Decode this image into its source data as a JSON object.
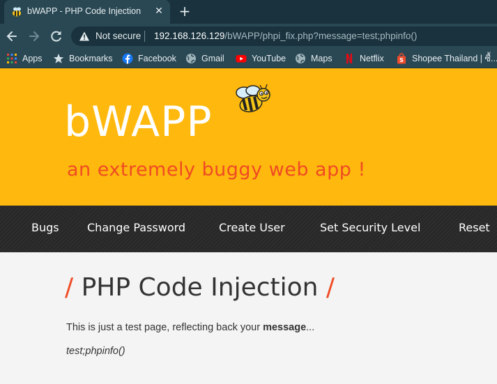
{
  "browser": {
    "tab_title": "bWAPP - PHP Code Injection",
    "close_glyph": "✕",
    "new_tab_glyph": "+",
    "security_label": "Not secure",
    "url_host": "192.168.126.129",
    "url_path": "/bWAPP/phpi_fix.php?message=test;phpinfo()",
    "bookmarks": [
      {
        "label": "Apps",
        "icon": "apps-grid-icon"
      },
      {
        "label": "Bookmarks",
        "icon": "star-icon"
      },
      {
        "label": "Facebook",
        "icon": "facebook-icon"
      },
      {
        "label": "Gmail",
        "icon": "globe-icon"
      },
      {
        "label": "YouTube",
        "icon": "youtube-icon"
      },
      {
        "label": "Maps",
        "icon": "globe-icon"
      },
      {
        "label": "Netflix",
        "icon": "netflix-icon"
      },
      {
        "label": "Shopee Thailand | ซื้...",
        "icon": "shopee-icon"
      }
    ]
  },
  "site": {
    "logo": "bWAPP",
    "tagline": "an extremely buggy web app !",
    "menu": [
      "Bugs",
      "Change Password",
      "Create User",
      "Set Security Level",
      "Reset"
    ]
  },
  "main": {
    "title": "PHP Code Injection",
    "slash": "/",
    "text_before": "This is just a test page, reflecting back your ",
    "text_bold": "message",
    "text_after": "...",
    "reflected": "test;phpinfo()"
  },
  "colors": {
    "hero": "#ffb80e",
    "accent": "#ef4b23",
    "menu_bg": "#2b2b2b",
    "chrome_dark": "#19323d",
    "chrome_light": "#2a4854"
  }
}
